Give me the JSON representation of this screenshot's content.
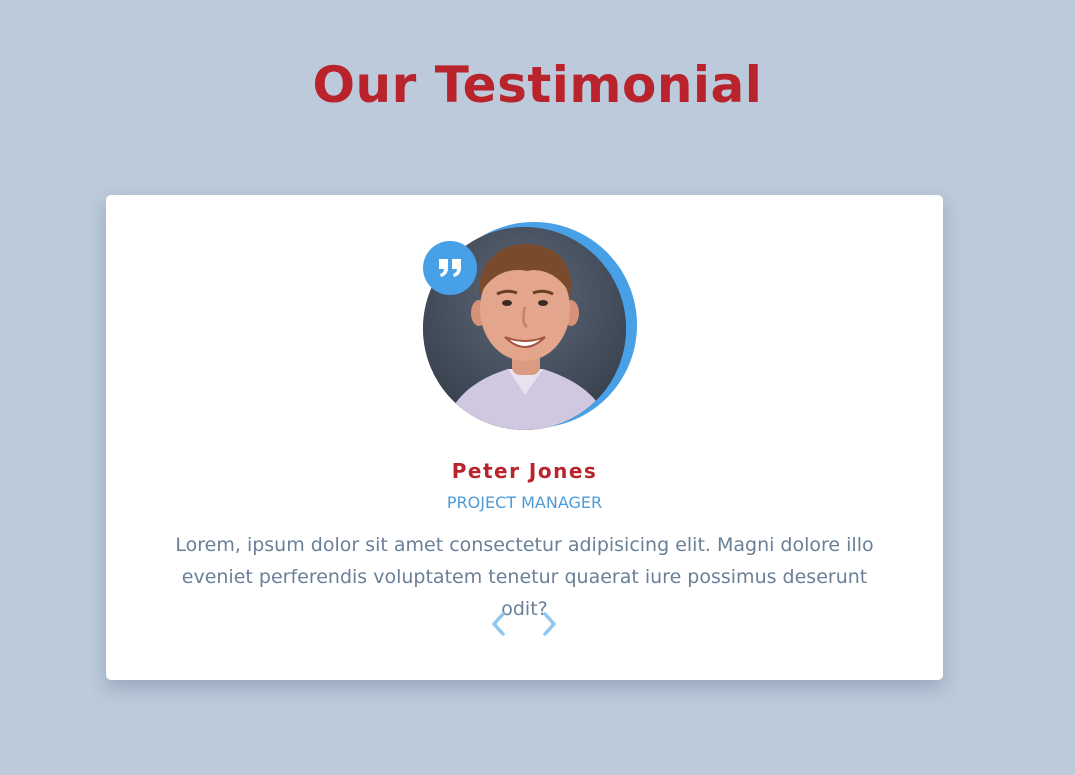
{
  "page": {
    "title": "Our Testimonial"
  },
  "testimonial": {
    "name": "Peter Jones",
    "role": "PROJECT MANAGER",
    "text": "Lorem, ipsum dolor sit amet consectetur adipisicing elit. Magni dolore illo eveniet perferendis voluptatem tenetur quaerat iure possimus deserunt odit?",
    "quote_icon": "quote-icon",
    "avatar_icon": "avatar-photo"
  },
  "navigation": {
    "prev_icon": "chevron-left-icon",
    "next_icon": "chevron-right-icon"
  },
  "colors": {
    "background": "#bccadb",
    "title": "#b9232b",
    "accent": "#48a0e6",
    "role": "#4d9bd8",
    "text": "#6a7f98",
    "nav_arrow": "#8ec8f2"
  }
}
